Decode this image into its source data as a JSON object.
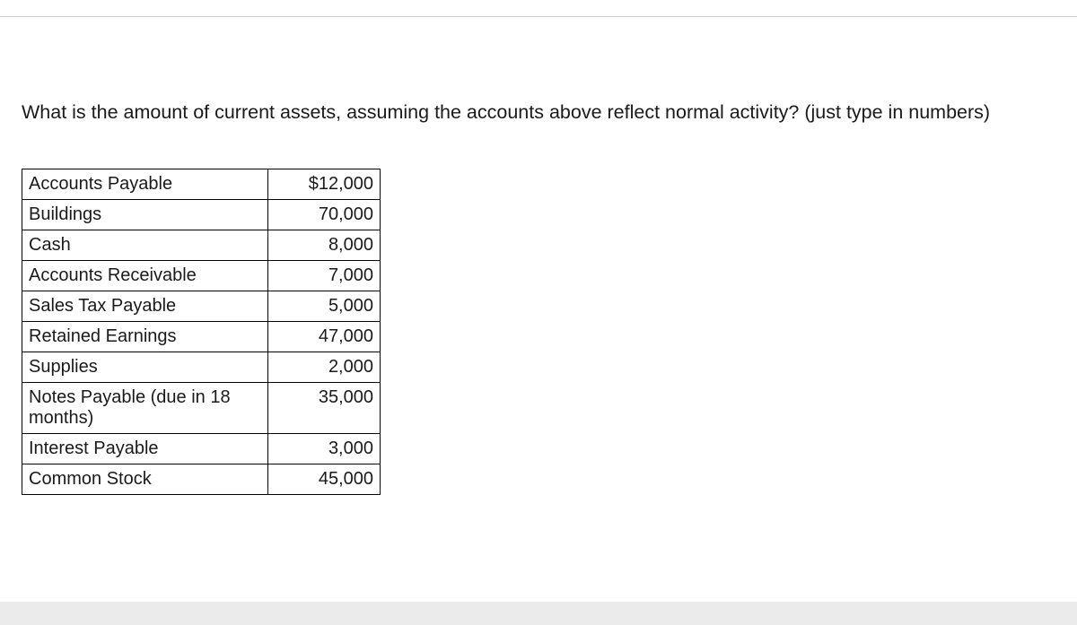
{
  "question": "What is the amount of current assets, assuming the accounts above reflect normal activity? (just type in numbers)",
  "rows": [
    {
      "label": "Accounts Payable",
      "value": "$12,000"
    },
    {
      "label": "Buildings",
      "value": "70,000"
    },
    {
      "label": "Cash",
      "value": "8,000"
    },
    {
      "label": "Accounts Receivable",
      "value": "7,000"
    },
    {
      "label": "Sales Tax Payable",
      "value": "5,000"
    },
    {
      "label": "Retained Earnings",
      "value": "47,000"
    },
    {
      "label": "Supplies",
      "value": "2,000"
    },
    {
      "label": "Notes Payable (due in 18 months)",
      "value": "35,000"
    },
    {
      "label": "Interest Payable",
      "value": "3,000"
    },
    {
      "label": "Common Stock",
      "value": "45,000"
    }
  ]
}
